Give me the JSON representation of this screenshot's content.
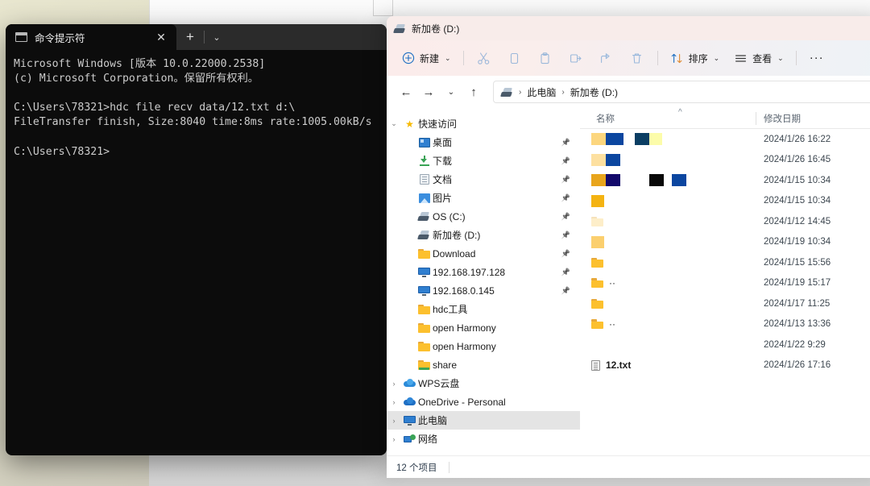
{
  "terminal": {
    "tab_title": "命令提示符",
    "tab_icon": "console-icon",
    "close_label": "✕",
    "newtab_label": "+",
    "dropdown_label": "⌄",
    "lines": [
      "Microsoft Windows [版本 10.0.22000.2538]",
      "(c) Microsoft Corporation。保留所有权利。",
      "",
      "C:\\Users\\78321>hdc file recv data/12.txt d:\\",
      "FileTransfer finish, Size:8040 time:8ms rate:1005.00kB/s",
      "",
      "C:\\Users\\78321>"
    ]
  },
  "explorer": {
    "title": "新加卷 (D:)",
    "toolbar": {
      "new_label": "新建",
      "cut_label": "剪切",
      "copy_label": "复制",
      "paste_label": "粘贴",
      "rename_label": "重命名",
      "share_label": "共享",
      "delete_label": "删除",
      "sort_label": "排序",
      "view_label": "查看",
      "more_label": "···",
      "chevron": "⌄"
    },
    "address": {
      "back_label": "←",
      "forward_label": "→",
      "recent_label": "⌄",
      "up_label": "↑",
      "crumbs": [
        "此电脑",
        "新加卷 (D:)"
      ],
      "separator": "›"
    },
    "sidebar": [
      {
        "label": "快速访问",
        "icon": "star-icon",
        "twisty": "⌄",
        "level": 0,
        "pin": false,
        "selected": false
      },
      {
        "label": "桌面",
        "icon": "desktop-icon",
        "twisty": "",
        "level": 1,
        "pin": true,
        "selected": false
      },
      {
        "label": "下载",
        "icon": "download-icon",
        "twisty": "",
        "level": 1,
        "pin": true,
        "selected": false
      },
      {
        "label": "文档",
        "icon": "document-icon",
        "twisty": "",
        "level": 1,
        "pin": true,
        "selected": false
      },
      {
        "label": "图片",
        "icon": "pictures-icon",
        "twisty": "",
        "level": 1,
        "pin": true,
        "selected": false
      },
      {
        "label": "OS (C:)",
        "icon": "drive-icon",
        "twisty": "",
        "level": 1,
        "pin": true,
        "selected": false
      },
      {
        "label": "新加卷 (D:)",
        "icon": "drive-icon",
        "twisty": "",
        "level": 1,
        "pin": true,
        "selected": false
      },
      {
        "label": "Download",
        "icon": "folder-icon",
        "twisty": "",
        "level": 1,
        "pin": true,
        "selected": false
      },
      {
        "label": "192.168.197.128",
        "icon": "monitor-icon",
        "twisty": "",
        "level": 1,
        "pin": true,
        "selected": false
      },
      {
        "label": "192.168.0.145",
        "icon": "monitor-icon",
        "twisty": "",
        "level": 1,
        "pin": true,
        "selected": false
      },
      {
        "label": "hdc工具",
        "icon": "folder-icon",
        "twisty": "",
        "level": 1,
        "pin": false,
        "selected": false
      },
      {
        "label": "open Harmony",
        "icon": "folder-icon",
        "twisty": "",
        "level": 1,
        "pin": false,
        "selected": false
      },
      {
        "label": "open Harmony",
        "icon": "folder-icon",
        "twisty": "",
        "level": 1,
        "pin": false,
        "selected": false
      },
      {
        "label": "share",
        "icon": "folder-shared-icon",
        "twisty": "",
        "level": 1,
        "pin": false,
        "selected": false
      },
      {
        "label": "WPS云盘",
        "icon": "cloud-icon",
        "twisty": "›",
        "level": 0,
        "pin": false,
        "selected": false
      },
      {
        "label": "OneDrive - Personal",
        "icon": "onedrive-icon",
        "twisty": "›",
        "level": 0,
        "pin": false,
        "selected": false
      },
      {
        "label": "此电脑",
        "icon": "monitor-icon",
        "twisty": "›",
        "level": 0,
        "pin": false,
        "selected": true
      },
      {
        "label": "网络",
        "icon": "network-icon",
        "twisty": "›",
        "level": 0,
        "pin": false,
        "selected": false
      }
    ],
    "columns": {
      "name": "名称",
      "date": "修改日期",
      "sort_indicator": "^"
    },
    "files": [
      {
        "icon": "redacted",
        "name": "",
        "date": "2024/1/26 16:22",
        "blocks": [
          {
            "c": "#fcd67e",
            "w": 18
          },
          {
            "c": "#0b46a0",
            "w": 22
          },
          {
            "c": "transparent",
            "w": 14
          },
          {
            "c": "#0b3e63",
            "w": 18
          },
          {
            "c": "#fcfcaa",
            "w": 16
          }
        ]
      },
      {
        "icon": "redacted",
        "name": "",
        "date": "2024/1/26 16:45",
        "blocks": [
          {
            "c": "#fde0a0",
            "w": 18
          },
          {
            "c": "#0b46a0",
            "w": 18
          }
        ]
      },
      {
        "icon": "redacted",
        "name": "",
        "date": "2024/1/15 10:34",
        "blocks": [
          {
            "c": "#e8a51c",
            "w": 18
          },
          {
            "c": "#12096b",
            "w": 18
          },
          {
            "c": "transparent",
            "w": 36
          },
          {
            "c": "#090909",
            "w": 18
          },
          {
            "c": "transparent",
            "w": 10
          },
          {
            "c": "#0b46a0",
            "w": 18
          }
        ]
      },
      {
        "icon": "redacted",
        "name": "",
        "date": "2024/1/15 10:34",
        "blocks": [
          {
            "c": "#f4b312",
            "w": 16
          }
        ]
      },
      {
        "icon": "folder-pale",
        "name": "",
        "date": "2024/1/12 14:45",
        "blocks": []
      },
      {
        "icon": "redacted",
        "name": "",
        "date": "2024/1/19 10:34",
        "blocks": [
          {
            "c": "#fbcf6e",
            "w": 16
          }
        ]
      },
      {
        "icon": "folder",
        "name": "",
        "date": "2024/1/15 15:56",
        "blocks": []
      },
      {
        "icon": "folder",
        "name": "··",
        "date": "2024/1/19 15:17",
        "blocks": []
      },
      {
        "icon": "folder",
        "name": "",
        "date": "2024/1/17 11:25",
        "blocks": []
      },
      {
        "icon": "folder",
        "name": "··",
        "date": "2024/1/13 13:36",
        "blocks": []
      },
      {
        "icon": "none",
        "name": "",
        "date": "2024/1/22 9:29",
        "blocks": []
      },
      {
        "icon": "txt",
        "name": "12.txt",
        "date": "2024/1/26 17:16",
        "blocks": [],
        "bold": true
      }
    ],
    "status": {
      "item_count": "12 个项目"
    }
  },
  "colors": {
    "accent": "#0b46a0",
    "toolbar_pink": "#fbeceb",
    "selection_gray": "#e4e4e4",
    "terminal_bg": "#0c0c0c"
  }
}
